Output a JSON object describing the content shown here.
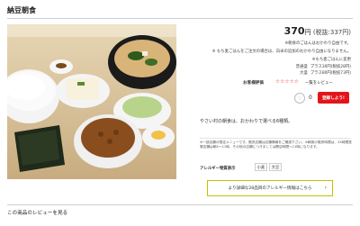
{
  "page_title": "納豆朝食",
  "price": {
    "amount": "370",
    "unit": "円",
    "tax_note": "(税抜:337円)"
  },
  "notices": [
    "※朝食のごはんはおかわり自由です。",
    "※ もち麦ごはんをご注文の場合は、白米の追加のおかわり自由になりません。"
  ],
  "rice_change": {
    "text": "※もち麦ごはんに変更",
    "normal_label": "普通盛",
    "normal_value": "プラス30円(税抜28円)",
    "large_label": "大盛",
    "large_value": "プラス80円(税抜73円)"
  },
  "rating": {
    "label": "お客様評価",
    "stars": "☆☆☆☆☆",
    "review_link": "一覧をレビュー"
  },
  "favorite": {
    "count": "0",
    "button_label": "登録しよう!"
  },
  "description": "やさい村の朝食は、おかわりで選べる6種類。",
  "notes": "※一部店舗の限定メニューです。販売店舗は店舗情報をご確認下さい。※朝食の販売時間は、24時間営業店舗は朝4～11時、その他の店舗につきましては開店時間～11時になります。",
  "allergy": {
    "label": "アレルギー物質表示",
    "items": [
      "小麦",
      "大豆"
    ],
    "detail_button": "より詳細な28品目のアレルギー情報はこちら",
    "chevron": "›"
  },
  "reviews_heading": "この商品のレビューを見る",
  "icons": {
    "favorite": "heart-icon",
    "chevron": "chevron-right-icon"
  },
  "colors": {
    "accent": "#e3151a",
    "button_border": "#c9c100"
  }
}
